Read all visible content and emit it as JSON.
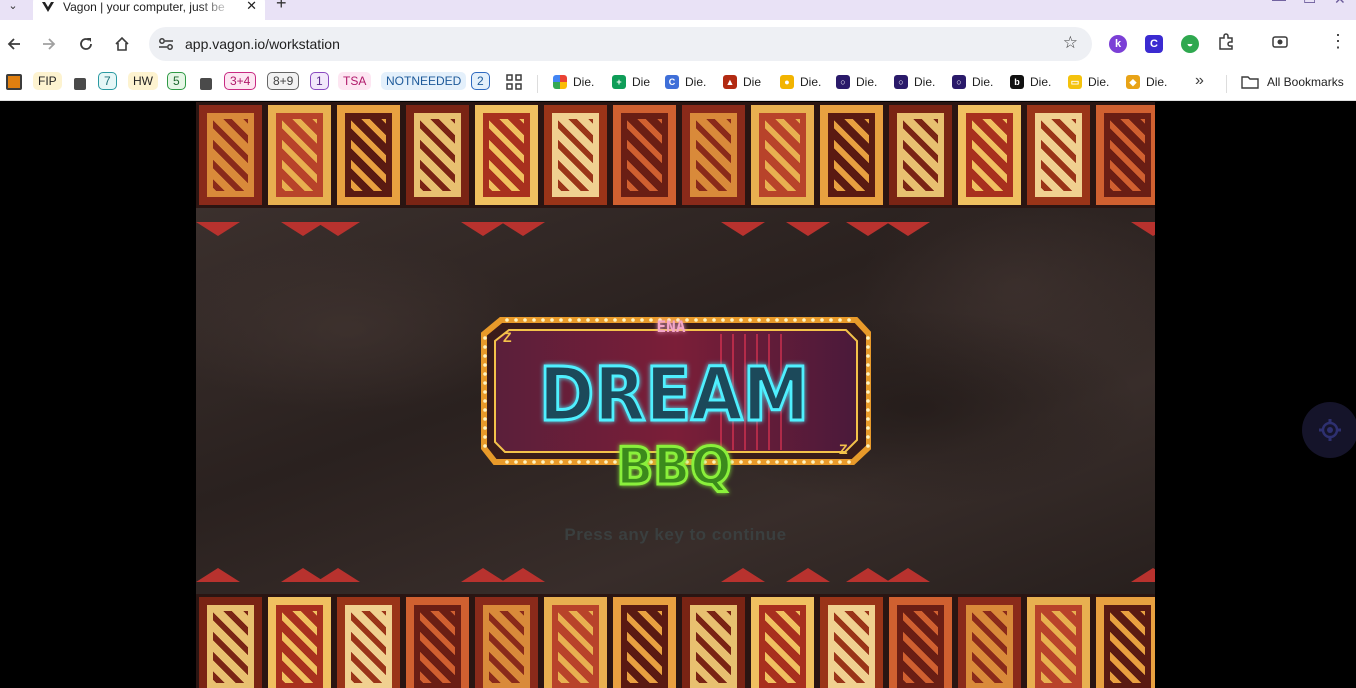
{
  "browser": {
    "tab": {
      "title": "Vagon | your computer, just be",
      "favicon": "vagon-icon"
    },
    "url": "app.vagon.io/workstation",
    "icons": [
      "back-icon",
      "forward-icon",
      "reload-icon",
      "home-icon",
      "site-settings-icon",
      "star-icon",
      "extensions-icon",
      "screen-capture-icon",
      "menu-icon"
    ],
    "extensions": [
      {
        "name": "k-extension",
        "label": "k",
        "color": "#7b3fd6"
      },
      {
        "name": "c-extension",
        "label": "C",
        "color": "#3b2bd1"
      },
      {
        "name": "grammar-extension",
        "label": "",
        "color": "#2fa84f"
      }
    ]
  },
  "bookmarks": {
    "items": [
      {
        "label": "FIP",
        "bg": "#fdf3d0",
        "fg": "#1f1f1f"
      },
      {
        "label": "7",
        "bg": "#e6f7f7",
        "fg": "#1a6f77",
        "border": "#2a9aa2"
      },
      {
        "label": "HW",
        "bg": "#fdf3d0",
        "fg": "#1f1f1f"
      },
      {
        "label": "5",
        "bg": "#e6f6e6",
        "fg": "#1e6a2e",
        "border": "#2f9a45"
      },
      {
        "label": "3+4",
        "bg": "#fde6f2",
        "fg": "#b0186a",
        "border": "#c82a82"
      },
      {
        "label": "8+9",
        "bg": "#f2f2f2",
        "fg": "#444",
        "border": "#666"
      },
      {
        "label": "1",
        "bg": "#f2e8fb",
        "fg": "#5a2a8a",
        "border": "#8a4ac0"
      },
      {
        "label": "TSA",
        "bg": "#fde6f2",
        "fg": "#b0186a"
      },
      {
        "label": "NOTNEEDED",
        "bg": "#e4f0fb",
        "fg": "#1e5a9a"
      },
      {
        "label": "2",
        "bg": "#e4f0fb",
        "fg": "#1e5a9a",
        "border": "#2f6ac0"
      }
    ],
    "links": [
      {
        "label": "Die.",
        "icon": "photos-icon",
        "color": "#ea4335"
      },
      {
        "label": "Die",
        "icon": "sheets-icon",
        "color": "#0f9d58"
      },
      {
        "label": "Die.",
        "icon": "c-icon",
        "color": "#3f6fd8"
      },
      {
        "label": "Die",
        "icon": "game-icon",
        "color": "#b22a12"
      },
      {
        "label": "Die.",
        "icon": "classroom-icon",
        "color": "#f2b400"
      },
      {
        "label": "Die.",
        "icon": "circle-icon",
        "color": "#2a1a6a"
      },
      {
        "label": "Die.",
        "icon": "circle-icon",
        "color": "#2a1a6a"
      },
      {
        "label": "Die.",
        "icon": "circle-icon",
        "color": "#2a1a6a"
      },
      {
        "label": "Die.",
        "icon": "b-icon",
        "color": "#111111"
      },
      {
        "label": "Die.",
        "icon": "slides-icon",
        "color": "#f4c20d"
      },
      {
        "label": "Die.",
        "icon": "shield-icon",
        "color": "#e8a317"
      }
    ],
    "more": "»",
    "all_bookmarks": "All Bookmarks"
  },
  "game": {
    "title_small": "ENA",
    "title_main": "DREAM",
    "title_sub": "BBQ",
    "prompt": "Press any key to continue"
  }
}
